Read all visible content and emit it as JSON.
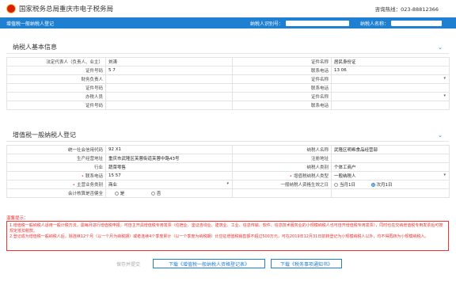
{
  "header": {
    "site_title": "国家税务总局重庆市电子税务局",
    "hotline": "咨询热线：023-88812366"
  },
  "bar": {
    "page_title": "增值税一般纳税人登记",
    "tin_label": "纳税人识别号：",
    "name_label": "纳税人名称："
  },
  "basic": {
    "title": "纳税人基本信息",
    "rows": [
      {
        "l1": "法定代表人（负责人、业主）",
        "v1": "刘涛",
        "l2": "证件名称",
        "v2": "居民身份证"
      },
      {
        "l1": "证件号码",
        "v1": "5               7",
        "l2": "联系电话",
        "v2": "13          06"
      },
      {
        "l1": "财务负责人",
        "v1": "",
        "l2": "证件名称",
        "v2": ""
      },
      {
        "l1": "证件号码",
        "v1": "",
        "l2": "联系电话",
        "v2": ""
      },
      {
        "l1": "办税人员",
        "v1": "",
        "l2": "证件名称",
        "v2": ""
      },
      {
        "l1": "证件号码",
        "v1": "",
        "l2": "联系电话",
        "v2": ""
      }
    ]
  },
  "vat": {
    "title": "增值税一般纳税人登记",
    "credit_code_label": "统一社会信用代码",
    "credit_code_value": "92                X1",
    "taxpayer_name_label": "纳税人名称",
    "taxpayer_name_value": "武隆区明希食品经营部",
    "address_label": "生产经营地址",
    "address_value": "重庆市武隆区芙蓉街道芙蓉中路43号",
    "reg_address_label": "注册地址",
    "reg_address_value": "",
    "industry_label": "行业",
    "industry_value": "蔬菜零售",
    "taxpayer_type_label": "纳税人类别",
    "taxpayer_type_value": "个体工商户",
    "phone_label": "联系电话",
    "phone_value": "15          57",
    "category_label": "增值税纳税人类型",
    "category_value": "一般纳税人",
    "business_label": "主营业务类别",
    "business_value": "商业",
    "effective_label": "一般纳税人资格生效之日",
    "effective_opt1": "当月1日",
    "effective_opt2": "次月1日",
    "accounting_label": "会计核算是否健全",
    "accounting_yes": "是",
    "accounting_no": "否"
  },
  "hint": {
    "title": "温馨提示：",
    "line1": "1.增值税一般纳税人适用一般计税方法，需每月进行增值税申报，可自主开具增值税专用发票（住宿业、鉴证咨询业、建筑业、工业、信息传输、软件、信息技术服务业的小规模纳税人也可自开增值税专用发票），同时也在交纳增值税专用发票后可按规定抵扣税款。",
    "line2": "2.登记成为增值税一般纳税人后，除连续12个月（以一个月为纳税期）或者连续4个季度累计（以一个季度为纳税期）计应征增值税销售额不超过500万元，可在2019年12月31日前转登记为小规模纳税人以外，均不得再转为小规模纳税人。"
  },
  "buttons": {
    "save": "保存并提交",
    "download1": "下载《增值税一般纳税人资格登记表》",
    "download2": "下载《税务事项通知书》"
  }
}
